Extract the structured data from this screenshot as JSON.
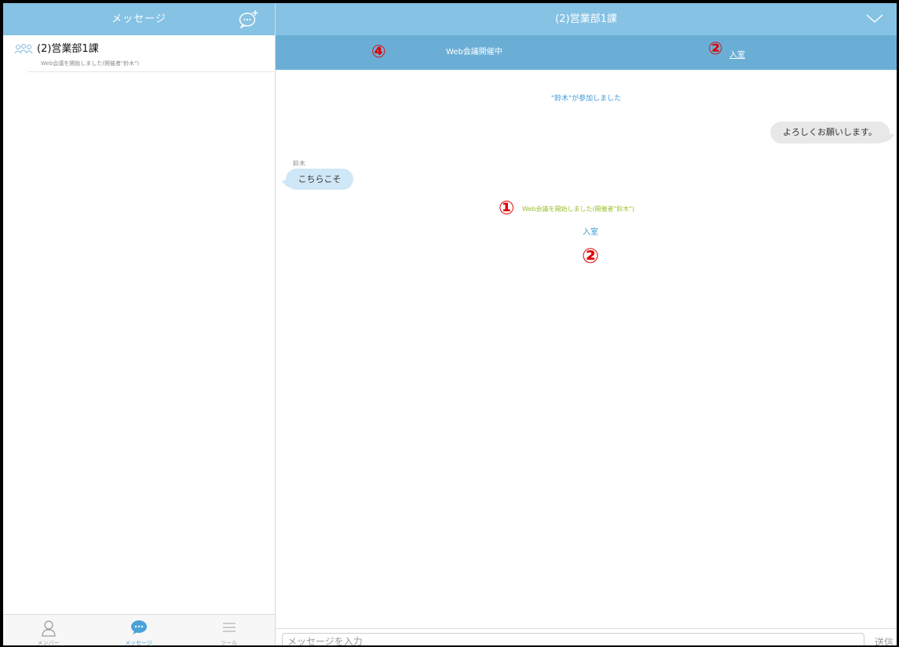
{
  "sidebar": {
    "title": "メッセージ",
    "conversation": {
      "name": "(2)営業部1課",
      "preview": "Web会議を開始しました(開催者\"鈴木\")"
    },
    "tabs": [
      {
        "label": "メンバー",
        "icon": "person-icon"
      },
      {
        "label": "メッセージ",
        "icon": "chat-bubble-icon"
      },
      {
        "label": "ツール",
        "icon": "menu-icon"
      }
    ]
  },
  "chat": {
    "title": "(2)営業部1課",
    "banner": {
      "text": "Web会議開催中",
      "join_label": "入室"
    },
    "messages": {
      "joined_notice": "\"鈴木\"が参加しました",
      "my_message": "よろしくお願いします。",
      "sender_name": "鈴木",
      "their_message": "こちらこそ",
      "conference_started": "Web会議を開始しました(開催者\"鈴木\")",
      "join_link": "入室"
    },
    "input": {
      "placeholder": "メッセージを入力",
      "send_label": "送信"
    }
  },
  "annotations": {
    "one": "①",
    "two": "②",
    "four": "④"
  },
  "colors": {
    "header": "#86c2e3",
    "banner": "#6aaed6",
    "link": "#3b9ad6",
    "conference_notice": "#9bbf2e",
    "annotation": "#e00000"
  }
}
